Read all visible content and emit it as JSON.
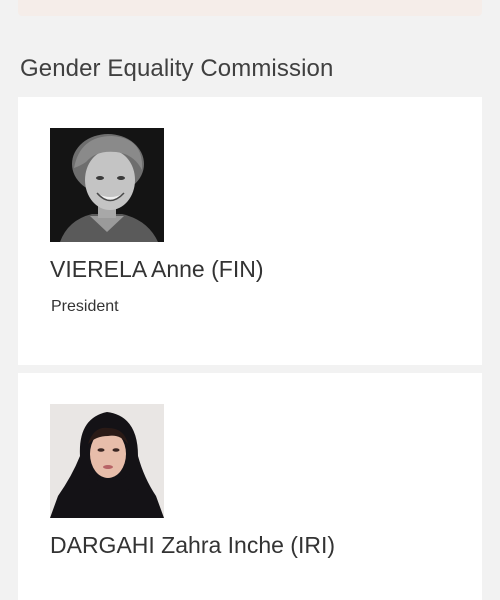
{
  "section": {
    "title": "Gender Equality Commission"
  },
  "members": [
    {
      "name": "VIERELA Anne (FIN)",
      "role": "President",
      "photo": "portrait-photo-black-and-white"
    },
    {
      "name": "DARGAHI Zahra Inche (IRI)",
      "role": "",
      "photo": "portrait-photo-hijab"
    }
  ]
}
